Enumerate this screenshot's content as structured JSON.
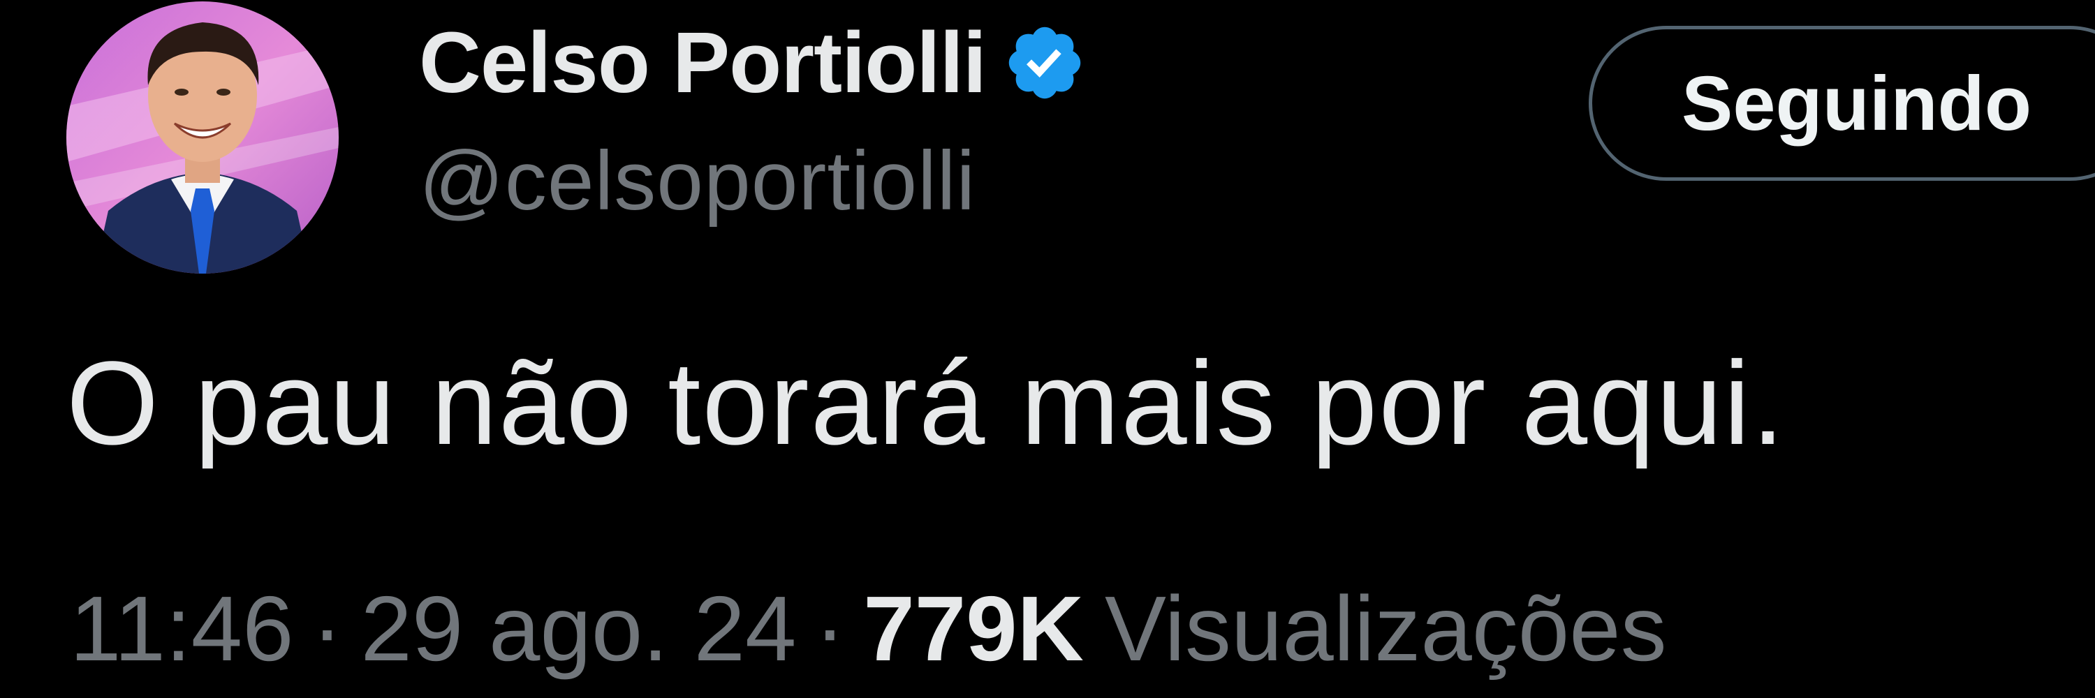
{
  "author": {
    "display_name": "Celso Portiolli",
    "handle": "@celsoportiolli",
    "verified": true,
    "avatar_icon": "profile-photo"
  },
  "follow_button": {
    "label": "Seguindo"
  },
  "tweet": {
    "text": "O pau não torará mais por aqui."
  },
  "meta": {
    "time": "11:46",
    "separator": "·",
    "date": "29 ago. 24",
    "views_count": "779K",
    "views_label": "Visualizações"
  },
  "colors": {
    "background": "#000000",
    "primary_text": "#e7e9ea",
    "secondary_text": "#71767b",
    "verified_blue": "#1d9bf0",
    "button_border": "#536471"
  }
}
